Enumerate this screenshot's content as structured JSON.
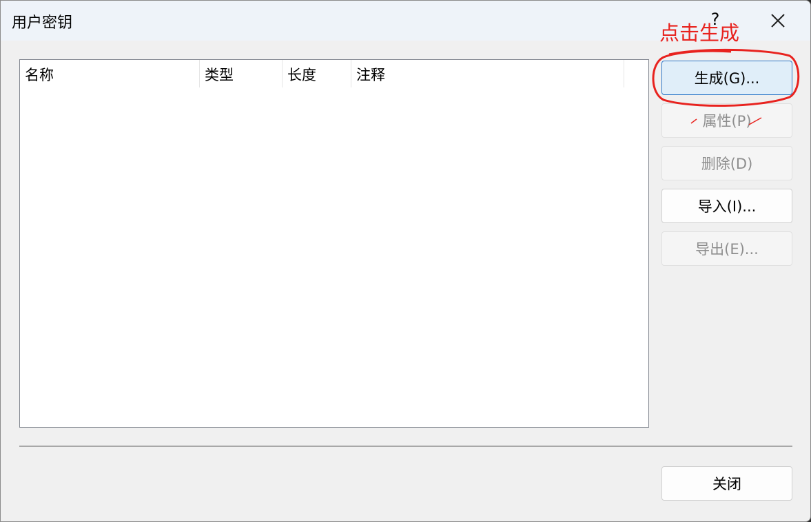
{
  "window": {
    "title": "用户密钥",
    "help_label": "?",
    "close_icon": "close-icon"
  },
  "list": {
    "columns": [
      "名称",
      "类型",
      "长度",
      "注释"
    ]
  },
  "buttons": {
    "generate": "生成(G)...",
    "properties": "属性(P)",
    "delete": "删除(D)",
    "import": "导入(I)...",
    "export": "导出(E)...",
    "close": "关闭"
  },
  "annotation": {
    "text": "点击生成",
    "color": "#e8221e"
  },
  "colors": {
    "default_button_border": "#2e78c9",
    "default_button_fill": "#e0eef9",
    "disabled_text": "#8e8e8e"
  }
}
